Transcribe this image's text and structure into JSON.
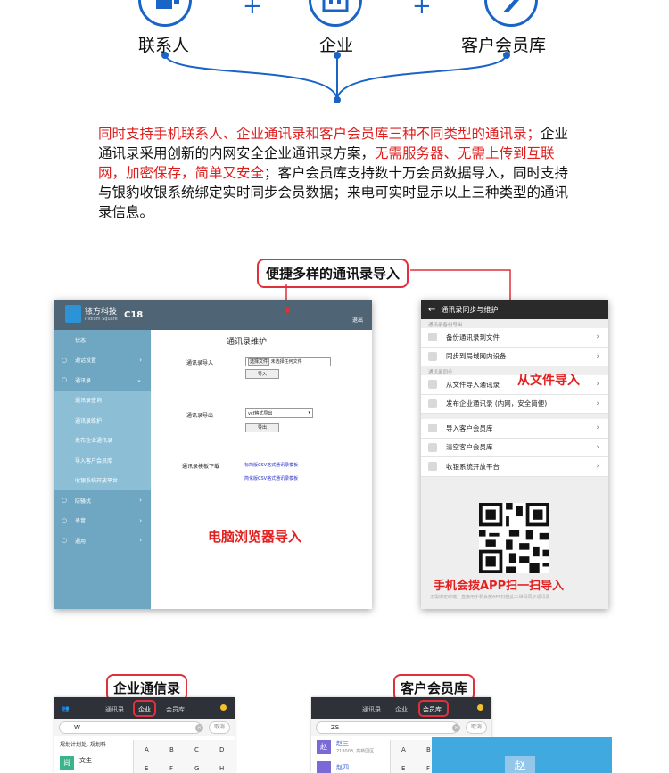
{
  "categories": [
    {
      "label": "联系人",
      "icon": "contacts-icon"
    },
    {
      "label": "企业",
      "icon": "enterprise-icon"
    },
    {
      "label": "客户会员库",
      "icon": "member-icon"
    }
  ],
  "description": {
    "part1": "同时支持手机联系人、企业通讯录和客户会员库三种不同类型的通讯录；",
    "part2": "企业通讯录采用创新的内网安全企业通讯录方案，",
    "part3": "无需服务器、无需上传到互联网，加密保存，简单又安全",
    "part4": "；客户会员库支持数十万会员数据导入，同时支持与银豹收银系统绑定实时同步会员数据；来电可实时显示以上三种类型的通讯录信息。"
  },
  "callout_import": "便捷多样的通讯录导入",
  "desktop": {
    "brand": "铱方科技",
    "brand_sub": "Iridium Square",
    "model": "C18",
    "logout": "退出",
    "menu": [
      {
        "label": "状态",
        "icon": "",
        "sub": false,
        "arrow": ""
      },
      {
        "label": "通话设置",
        "icon": "person-icon",
        "sub": false,
        "arrow": "›"
      },
      {
        "label": "通讯录",
        "icon": "contacts-icon",
        "sub": false,
        "arrow": "⌄"
      },
      {
        "label": "通讯录查询",
        "icon": "",
        "sub": true,
        "arrow": ""
      },
      {
        "label": "通讯录维护",
        "icon": "",
        "sub": true,
        "arrow": ""
      },
      {
        "label": "发布企业通讯录",
        "icon": "",
        "sub": true,
        "arrow": ""
      },
      {
        "label": "导入客户会员库",
        "icon": "",
        "sub": true,
        "arrow": ""
      },
      {
        "label": "收银系统开放平台",
        "icon": "",
        "sub": true,
        "arrow": ""
      },
      {
        "label": "防骚扰",
        "icon": "shield-icon",
        "sub": false,
        "arrow": "›"
      },
      {
        "label": "录音",
        "icon": "bell-icon",
        "sub": false,
        "arrow": "›"
      },
      {
        "label": "通用",
        "icon": "star-icon",
        "sub": false,
        "arrow": "›"
      }
    ],
    "page_title": "通讯录维护",
    "import_label": "通讯录导入",
    "choose_file": "选择文件",
    "no_file": "未选择任何文件",
    "import_btn": "导入",
    "export_label": "通讯录导出",
    "export_format": "vcf格式导出",
    "export_btn": "导出",
    "template_label": "通讯录模板下载",
    "template_link1": "标简版CSV格式通讯录模板",
    "template_link2": "简化版CSV格式通讯录模板",
    "highlight": "电脑浏览器导入"
  },
  "phone": {
    "title": "通讯录同步与维护",
    "section1": "通讯录备份导出",
    "section2": "通讯录同步",
    "rows1": [
      "备份通讯录到文件",
      "同步到局域网内设备"
    ],
    "rows2": [
      "从文件导入通讯录",
      "发布企业通讯录 (内网，安全简便)"
    ],
    "rows3": [
      "导入客户会员库",
      "清空客户会员库",
      "收银系统开放平台"
    ],
    "highlight_file": "从文件导入",
    "highlight_scan": "手机会拨APP扫一扫导入",
    "footer": "无需绑定终端，直接用手机会拨APP扫描此二维码同步通讯录"
  },
  "callout_enterprise": "企业通信录",
  "callout_member": "客户会员库",
  "mini1": {
    "tabs": [
      "通讯录",
      "企业",
      "会员库"
    ],
    "search": "W",
    "cancel": "取消",
    "result_header": "规划计划处, 规划科",
    "entry_name": "文生",
    "avatar": "尚"
  },
  "mini2": {
    "tabs": [
      "通讯录",
      "企业",
      "会员库"
    ],
    "search": "ZS",
    "cancel": "取消",
    "entry1_name": "赵三",
    "entry1_num": "218003, 高新园区",
    "entry2_name": "赵四",
    "overlay_char": "赵"
  },
  "keyboard": [
    "A",
    "B",
    "C",
    "D",
    "E",
    "F",
    "G",
    "H"
  ],
  "colors": {
    "accent": "#1a64c8",
    "highlight": "#e32020",
    "callout_border": "#e0303b"
  }
}
